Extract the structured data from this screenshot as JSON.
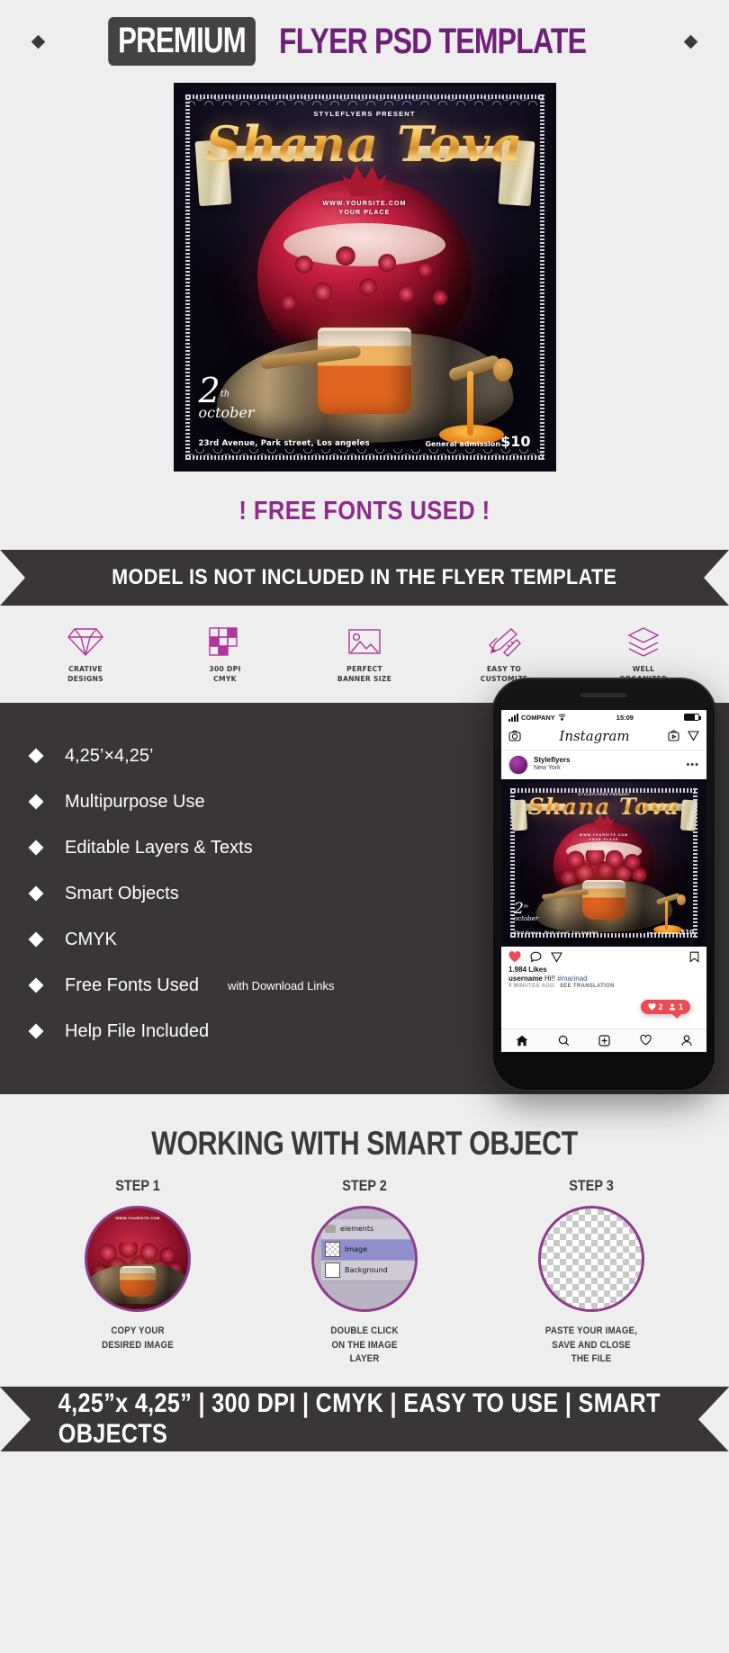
{
  "header": {
    "badge": "PREMIUM",
    "title": "FLYER PSD TEMPLATE",
    "diamond_icon": "diamond-icon"
  },
  "flyer": {
    "present": "STYLEFLYERS PRESENT",
    "title": "Shana Tova",
    "site": "WWW.YOURSITE.COM",
    "place": "YOUR PLACE",
    "date_number": "2",
    "date_suffix": "th",
    "date_month": "october",
    "address": "23rd Avenue, Park street, Los angeles",
    "admission_label": "General admission",
    "admission_price": "$10"
  },
  "free_fonts": "! FREE FONTS USED !",
  "ribbon": "MODEL IS NOT INCLUDED  IN THE FLYER TEMPLATE",
  "feature_icons": [
    {
      "icon": "diamond-icon",
      "line1": "CRATIVE",
      "line2": "DESIGNS"
    },
    {
      "icon": "grid-icon",
      "line1": "300 DPI",
      "line2": "CMYK"
    },
    {
      "icon": "image-icon",
      "line1": "PERFECT",
      "line2": "BANNER SIZE"
    },
    {
      "icon": "pencil-ruler-icon",
      "line1": "EASY TO",
      "line2": "CUSTOMIZE"
    },
    {
      "icon": "layers-icon",
      "line1": "WELL",
      "line2": "ORGANIZED"
    }
  ],
  "features": [
    {
      "label": "4,25’×4,25’",
      "sub": ""
    },
    {
      "label": "Multipurpose Use",
      "sub": ""
    },
    {
      "label": "Editable Layers & Texts",
      "sub": ""
    },
    {
      "label": "Smart Objects",
      "sub": ""
    },
    {
      "label": "CMYK",
      "sub": ""
    },
    {
      "label": "Free Fonts Used",
      "sub": "with Download Links"
    },
    {
      "label": "Help File Included",
      "sub": ""
    }
  ],
  "phone": {
    "carrier": "COMPANY",
    "time": "15:09",
    "wifi_icon": "wifi-icon",
    "signal_icon": "signal-bars-icon",
    "battery_icon": "battery-icon",
    "camera_icon": "camera-icon",
    "logo": "Instagram",
    "tv_icon": "igtv-icon",
    "send_icon": "send-icon",
    "username": "Styleflyers",
    "location": "New York",
    "more_icon": "more-dots-icon",
    "heart_icon": "heart-icon",
    "comment_icon": "comment-icon",
    "share_icon": "share-icon",
    "bookmark_icon": "bookmark-icon",
    "likes": "1.984 Likes",
    "caption_user": "username",
    "caption_text": "Hi!!",
    "caption_tag": "#marinad",
    "time_ago": "9 MINUTES AGO",
    "see_translation": "SEE TRANSLATION",
    "badge_likes": "2",
    "badge_follows": "1",
    "tabs": [
      "home-icon",
      "search-icon",
      "add-icon",
      "activity-icon",
      "profile-icon"
    ]
  },
  "smart": {
    "title": "WORKING WITH SMART OBJECT",
    "steps": [
      {
        "label": "STEP 1",
        "caption": "COPY YOUR\nDESIRED IMAGE"
      },
      {
        "label": "STEP 2",
        "caption": "DOUBLE CLICK\nON THE IMAGE\nLAYER"
      },
      {
        "label": "STEP 3",
        "caption": "PASTE YOUR IMAGE,\nSAVE AND CLOSE\nTHE FILE"
      }
    ],
    "layers": [
      {
        "name": "elements",
        "type": "folder"
      },
      {
        "name": "Image",
        "type": "smart"
      },
      {
        "name": "Background",
        "type": "plain"
      }
    ]
  },
  "bottom_banner": "4,25”x 4,25” |  300 DPI  |  CMYK  |  EASY TO USE  |  SMART OBJECTS",
  "colors": {
    "accent_purple": "#6d2077",
    "dark": "#383636",
    "page_bg": "#efeeee",
    "magenta": "#b0359b",
    "instagram_red": "#ed4956"
  }
}
